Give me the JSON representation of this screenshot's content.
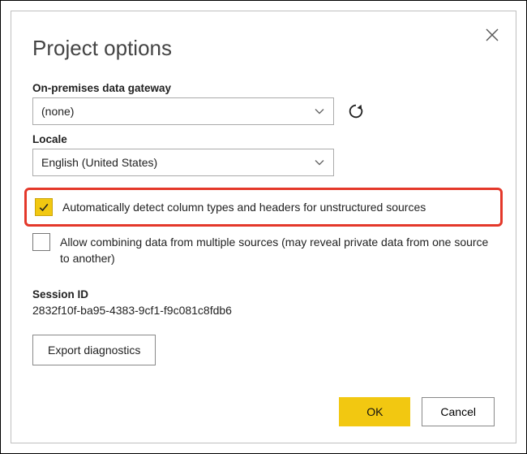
{
  "dialog": {
    "title": "Project options",
    "gateway": {
      "label": "On-premises data gateway",
      "value": "(none)"
    },
    "locale": {
      "label": "Locale",
      "value": "English (United States)"
    },
    "checkbox_autodetect": {
      "checked": true,
      "label": "Automatically detect column types and headers for unstructured sources"
    },
    "checkbox_combine": {
      "checked": false,
      "label": "Allow combining data from multiple sources (may reveal private data from one source to another)"
    },
    "session": {
      "label": "Session ID",
      "value": "2832f10f-ba95-4383-9cf1-f9c081c8fdb6"
    },
    "export_diagnostics": "Export diagnostics",
    "ok": "OK",
    "cancel": "Cancel"
  }
}
